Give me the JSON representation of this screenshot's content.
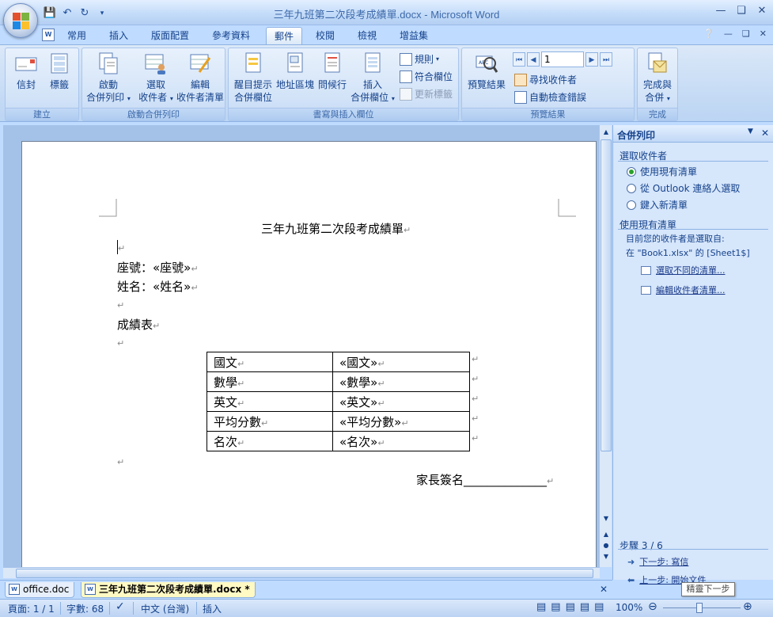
{
  "window": {
    "title": "三年九班第二次段考成績單.docx - Microsoft Word",
    "min_icon": "minimize-icon",
    "max_icon": "restore-icon",
    "close_icon": "close-icon"
  },
  "tabs": [
    {
      "label": "常用"
    },
    {
      "label": "插入"
    },
    {
      "label": "版面配置"
    },
    {
      "label": "參考資料"
    },
    {
      "label": "郵件"
    },
    {
      "label": "校閱"
    },
    {
      "label": "檢視"
    },
    {
      "label": "增益集"
    }
  ],
  "ribbon": {
    "create": {
      "label": "建立",
      "envelope": "信封",
      "labels": "標籤"
    },
    "start": {
      "label": "啟動合併列印",
      "start_merge_1": "啟動",
      "start_merge_2": "合併列印",
      "select_1": "選取",
      "select_2": "收件者",
      "edit_1": "編輯",
      "edit_2": "收件者清單"
    },
    "write": {
      "label": "書寫與插入欄位",
      "highlight_1": "醒目提示",
      "highlight_2": "合併欄位",
      "address": "地址區塊",
      "greeting": "問候行",
      "insert_1": "插入",
      "insert_2": "合併欄位",
      "rules": "規則",
      "match": "符合欄位",
      "update": "更新標籤"
    },
    "preview": {
      "label": "預覽結果",
      "preview_btn": "預覽結果",
      "record": "1",
      "find": "尋找收件者",
      "check": "自動檢查錯誤"
    },
    "finish": {
      "label": "完成",
      "finish_1": "完成與",
      "finish_2": "合併"
    }
  },
  "document": {
    "title": "三年九班第二次段考成績單",
    "seat": "座號：«座號»",
    "name": "姓名：«姓名»",
    "table_heading": "成績表",
    "table": [
      [
        "國文",
        "«國文»"
      ],
      [
        "數學",
        "«數學»"
      ],
      [
        "英文",
        "«英文»"
      ],
      [
        "平均分數",
        "«平均分數»"
      ],
      [
        "名次",
        "«名次»"
      ]
    ],
    "signature": "家長簽名______________"
  },
  "pane": {
    "title": "合併列印",
    "select_heading": "選取收件者",
    "opt_existing": "使用現有清單",
    "opt_outlook": "從 Outlook 連絡人選取",
    "opt_new": "鍵入新清單",
    "existing_heading": "使用現有清單",
    "current_1": "目前您的收件者是選取自:",
    "current_2": "在 \"Book1.xlsx\" 的 [Sheet1$]",
    "link_different": "選取不同的清單...",
    "link_edit": "編輯收件者清單...",
    "step": "步驟 3 / 6",
    "next": "下一步: 寫信",
    "prev": "上一步: 開始文件",
    "tooltip": "精靈下一步"
  },
  "doc_tabs": [
    {
      "label": "office.doc"
    },
    {
      "label": "三年九班第二次段考成績單.docx *"
    }
  ],
  "status": {
    "page": "頁面: 1 / 1",
    "words": "字數: 68",
    "lang": "中文 (台灣)",
    "mode": "插入",
    "zoom": "100%"
  }
}
